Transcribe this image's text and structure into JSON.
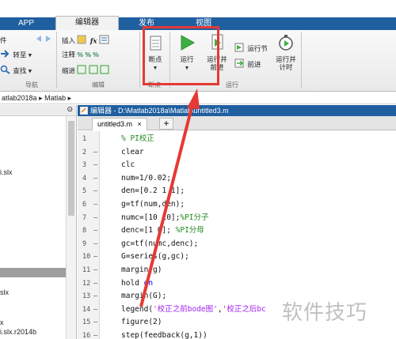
{
  "tabs": [
    {
      "label": "APP"
    },
    {
      "label": "编辑器"
    },
    {
      "label": "发布"
    },
    {
      "label": "视图"
    }
  ],
  "ribbon": {
    "nav_left": [
      {
        "label": "件"
      },
      {
        "label": "转至 ▾"
      },
      {
        "label": "查找 ▾"
      }
    ],
    "nav_group_label": "导航",
    "edit_items": [
      {
        "label": "插入"
      },
      {
        "label": "注释"
      },
      {
        "label": "缩进"
      }
    ],
    "edit_group_label": "编辑",
    "breakpoint_label": "断点",
    "breakpoint_group_label": "断点",
    "run_label": "运行",
    "run_advance_label": "运行并前进",
    "run_section_label": "运行节",
    "advance_label": "前进",
    "run_time_label": "运行并计时",
    "run_group_label": "运行"
  },
  "pathbar": {
    "segments": [
      "atlab2018a",
      "Matlab"
    ]
  },
  "left_panel": {
    "items": [
      {
        "label": "i.slx"
      },
      {
        "label": "slx"
      },
      {
        "label": "x"
      },
      {
        "label": "i.slx.r2014b"
      }
    ]
  },
  "editor": {
    "title": "编辑器 - D:\\Matlab2018a\\Matlab\\untitled3.m",
    "tab_label": "untitled3.m",
    "tab_close": "×",
    "add_tab": "+",
    "lines": [
      {
        "n": "1",
        "dash": "",
        "parts": [
          {
            "t": "  % PI校正",
            "c": "comment"
          }
        ]
      },
      {
        "n": "2",
        "dash": "—",
        "parts": [
          {
            "t": "clear",
            "c": ""
          }
        ]
      },
      {
        "n": "3",
        "dash": "—",
        "parts": [
          {
            "t": "clc",
            "c": ""
          }
        ]
      },
      {
        "n": "4",
        "dash": "—",
        "parts": [
          {
            "t": "num=1/0.02;",
            "c": ""
          }
        ]
      },
      {
        "n": "5",
        "dash": "—",
        "parts": [
          {
            "t": "den=[0.2 1 1];",
            "c": ""
          }
        ]
      },
      {
        "n": "6",
        "dash": "—",
        "parts": [
          {
            "t": "g=tf(num,den);",
            "c": ""
          }
        ]
      },
      {
        "n": "7",
        "dash": "—",
        "parts": [
          {
            "t": "numc=[10 10];",
            "c": ""
          },
          {
            "t": "%PI分子",
            "c": "comment"
          }
        ]
      },
      {
        "n": "8",
        "dash": "—",
        "parts": [
          {
            "t": "denc=[1 0];  ",
            "c": ""
          },
          {
            "t": "%PI分母",
            "c": "comment"
          }
        ]
      },
      {
        "n": "9",
        "dash": "—",
        "parts": [
          {
            "t": "gc=tf(numc,denc);",
            "c": ""
          }
        ]
      },
      {
        "n": "10",
        "dash": "—",
        "parts": [
          {
            "t": "G=series(g,gc);",
            "c": ""
          }
        ]
      },
      {
        "n": "11",
        "dash": "—",
        "parts": [
          {
            "t": "margin(g)",
            "c": ""
          }
        ]
      },
      {
        "n": "12",
        "dash": "—",
        "parts": [
          {
            "t": "hold ",
            "c": ""
          },
          {
            "t": "on",
            "c": "kw"
          }
        ]
      },
      {
        "n": "13",
        "dash": "—",
        "parts": [
          {
            "t": "margin(G);",
            "c": ""
          }
        ]
      },
      {
        "n": "14",
        "dash": "—",
        "parts": [
          {
            "t": "legend(",
            "c": ""
          },
          {
            "t": "'校正之前bode图'",
            "c": "string"
          },
          {
            "t": ",",
            "c": ""
          },
          {
            "t": "'校正之后bc",
            "c": "string"
          }
        ]
      },
      {
        "n": "15",
        "dash": "—",
        "parts": [
          {
            "t": "figure(2)",
            "c": ""
          }
        ]
      },
      {
        "n": "16",
        "dash": "—",
        "parts": [
          {
            "t": "step(feedback(g,1))",
            "c": ""
          }
        ]
      }
    ]
  },
  "watermark": "软件技巧",
  "colors": {
    "accent": "#1f5fa0",
    "highlight": "#e53935",
    "comment": "#228b22",
    "string": "#a020f0",
    "keyword": "#0000ff"
  }
}
